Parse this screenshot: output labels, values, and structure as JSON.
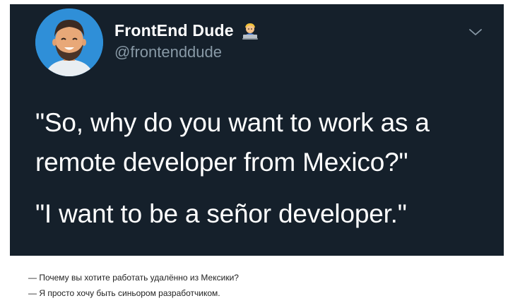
{
  "tweet": {
    "display_name": "FrontEnd Dude",
    "emoji": "man-technologist-emoji",
    "handle": "@frontenddude",
    "menu_icon": "chevron-down-icon",
    "paragraphs": [
      "\"So, why do you want to work as a remote developer from Mexico?\"",
      "\"I want to be a señor developer.\""
    ]
  },
  "caption": {
    "lines": [
      "— Почему вы хотите работать удалённо из Мексики?",
      "— Я просто хочу быть синьором разработчиком."
    ]
  },
  "colors": {
    "card_background": "#15202b",
    "avatar_background": "#1d9bf0",
    "handle_color": "#8899a6",
    "text_color": "#ffffff"
  }
}
